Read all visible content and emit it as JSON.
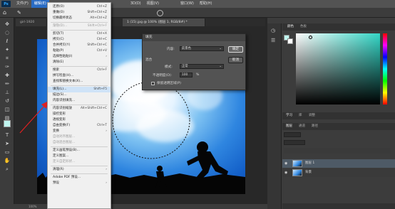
{
  "menubar": {
    "logo": "Ps",
    "items": [
      "文件(F)",
      "编辑(E)",
      "",
      "",
      "",
      "",
      "",
      "3D(D)",
      "视图(V)",
      "",
      "窗口(W)",
      "帮助(H)"
    ]
  },
  "doc_tabs": {
    "left": "girl-1920",
    "main": "1 (15).jpg @ 100% (图层 1, RGB/8#) *"
  },
  "edit_menu": {
    "items": [
      {
        "label": "还原(O)",
        "shortcut": "Ctrl+Z"
      },
      {
        "label": "重做(O)",
        "shortcut": "Shift+Ctrl+Z"
      },
      {
        "label": "切换最终状态",
        "shortcut": "Alt+Ctrl+Z"
      },
      {
        "label": "渐隐(D)...",
        "shortcut": "Shift+Ctrl+F"
      },
      {
        "label": "剪切(T)",
        "shortcut": "Ctrl+X"
      },
      {
        "label": "拷贝(C)",
        "shortcut": "Ctrl+C"
      },
      {
        "label": "合并拷贝(Y)",
        "shortcut": "Shift+Ctrl+C"
      },
      {
        "label": "粘贴(P)",
        "shortcut": "Ctrl+V"
      },
      {
        "label": "选择性粘贴(I)",
        "shortcut": ""
      },
      {
        "label": "清除(E)",
        "shortcut": ""
      },
      {
        "label": "搜索",
        "shortcut": "Ctrl+F"
      },
      {
        "label": "拼写检查(H)...",
        "shortcut": ""
      },
      {
        "label": "查找和替换文本(X)...",
        "shortcut": ""
      },
      {
        "label": "填充(L)...",
        "shortcut": "Shift+F5"
      },
      {
        "label": "描边(S)...",
        "shortcut": ""
      },
      {
        "label": "内容识别填充...",
        "shortcut": ""
      },
      {
        "label": "内容识别缩放",
        "shortcut": "Alt+Shift+Ctrl+C"
      },
      {
        "label": "操控变形",
        "shortcut": ""
      },
      {
        "label": "透视变形",
        "shortcut": ""
      },
      {
        "label": "自由变换(F)",
        "shortcut": "Ctrl+T"
      },
      {
        "label": "变换",
        "shortcut": ""
      },
      {
        "label": "自动对齐图层...",
        "shortcut": ""
      },
      {
        "label": "自动混合图层...",
        "shortcut": ""
      },
      {
        "label": "定义画笔预设(B)...",
        "shortcut": ""
      },
      {
        "label": "定义图案...",
        "shortcut": ""
      },
      {
        "label": "定义自定形状...",
        "shortcut": ""
      },
      {
        "label": "清理(R)",
        "shortcut": ""
      },
      {
        "label": "Adobe PDF 预设...",
        "shortcut": ""
      },
      {
        "label": "预设",
        "shortcut": ""
      }
    ]
  },
  "fill_dialog": {
    "title": "填充",
    "content_label": "内容:",
    "content_value": "前景色",
    "blend_group": "混合",
    "mode_label": "模式:",
    "mode_value": "正常",
    "opacity_label": "不透明度(O):",
    "opacity_value": "100",
    "opacity_unit": "%",
    "preserve_label": "保留透明区域(P)",
    "ok_label": "确定",
    "cancel_label": "取消"
  },
  "right_panel": {
    "color_tabs": [
      "颜色",
      "色板"
    ],
    "lower_tabs": [
      "学习",
      "库",
      "调整"
    ],
    "layers_tabs": [
      "图层",
      "通道",
      "路径"
    ],
    "layers": [
      {
        "name": "图层 1",
        "selected": true
      },
      {
        "name": "背景",
        "selected": false
      }
    ],
    "picker_hue": "#33d6c6",
    "fg_color": "#bff5ef"
  },
  "status": {
    "zoom": "100%"
  },
  "colors": {
    "highlight": "#2a6cc4",
    "arrow": "#e02020"
  }
}
